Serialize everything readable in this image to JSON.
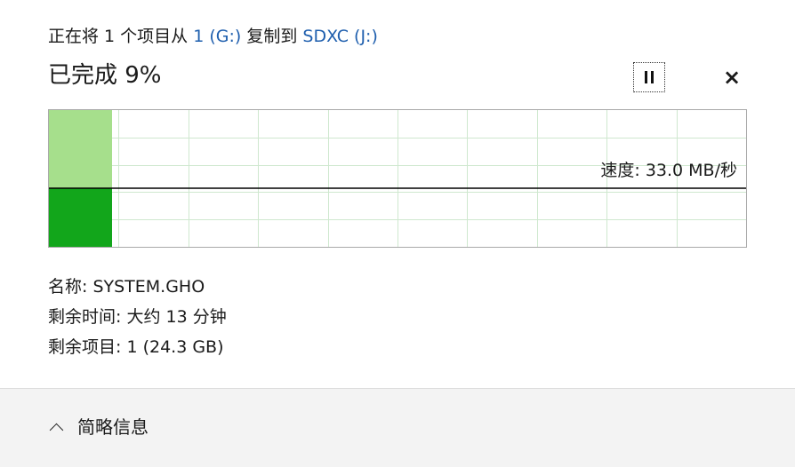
{
  "header": {
    "prefix": "正在将 1 个项目从",
    "source": "1 (G:)",
    "middle": "复制到",
    "destination": "SDXC (J:)"
  },
  "progress": {
    "title": "已完成 9%",
    "percent": 9
  },
  "controls": {
    "pause_icon": "pause-icon",
    "close_label": "×"
  },
  "graph": {
    "speed_label": "速度: 33.0 MB/秒",
    "colors": {
      "completed_light": "#a6df8c",
      "completed_dark": "#12a61b",
      "grid": "#cfe8cf",
      "border": "#a9a9a9",
      "speed_line": "#000000"
    }
  },
  "details": {
    "name": "名称: SYSTEM.GHO",
    "time_remaining": "剩余时间: 大约 13 分钟",
    "items_remaining": "剩余项目: 1 (24.3 GB)"
  },
  "footer": {
    "more_label": "简略信息",
    "chevron_icon": "chevron-up-icon"
  }
}
